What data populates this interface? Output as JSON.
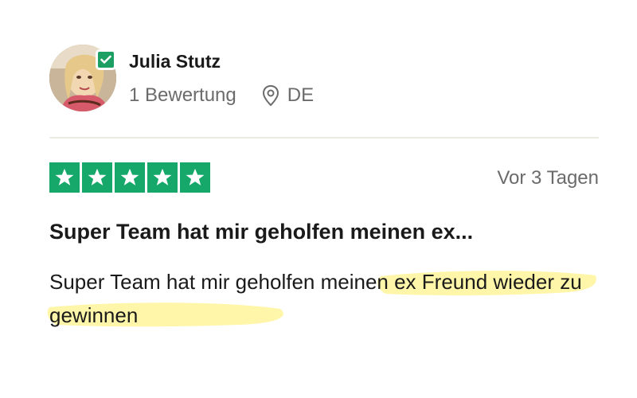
{
  "reviewer": {
    "name": "Julia Stutz",
    "review_count": "1 Bewertung",
    "country": "DE"
  },
  "rating": {
    "stars": 5,
    "max_stars": 5,
    "date": "Vor 3 Tagen"
  },
  "review": {
    "title": "Super Team hat mir geholfen meinen ex...",
    "body": "Super Team hat mir geholfen meinen ex Freund wieder zu gewinnen"
  },
  "colors": {
    "star_green": "#16a86a",
    "verified_green": "#1c9f62",
    "highlight_yellow": "#fff59a"
  },
  "icons": {
    "verified": "check-icon",
    "location": "location-pin-icon",
    "star": "star-icon"
  }
}
